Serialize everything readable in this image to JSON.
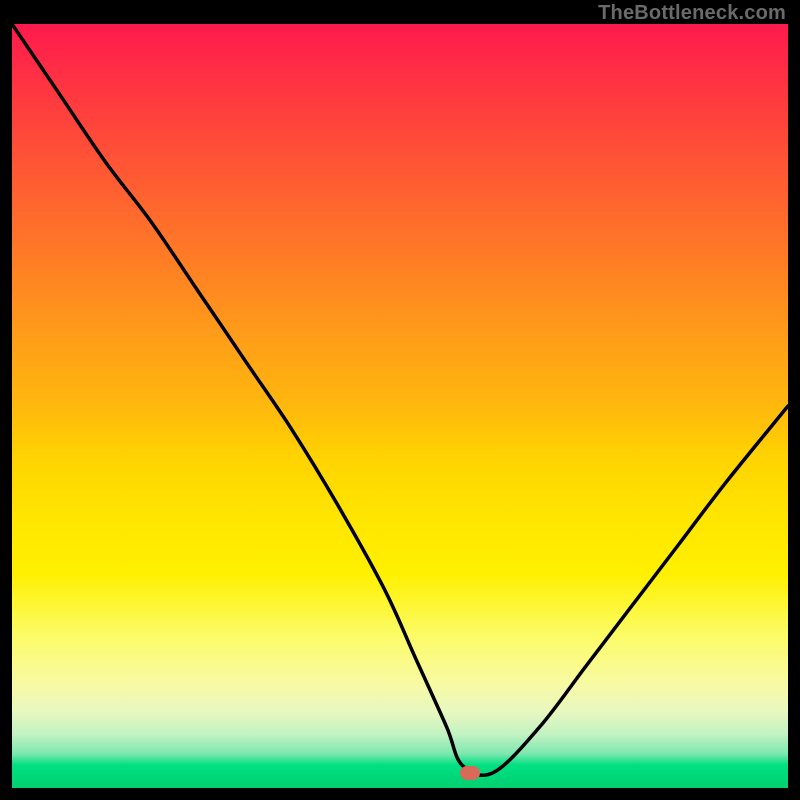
{
  "watermark": "TheBottleneck.com",
  "colors": {
    "frame": "#000000",
    "curve": "#000000",
    "marker": "#d86a5a"
  },
  "chart_data": {
    "type": "line",
    "title": "",
    "xlabel": "",
    "ylabel": "",
    "xlim": [
      0,
      100
    ],
    "ylim": [
      0,
      100
    ],
    "grid": false,
    "legend": false,
    "background": "vertical-gradient-red-to-green",
    "series": [
      {
        "name": "bottleneck-curve",
        "x": [
          0,
          6,
          12,
          18,
          24,
          30,
          36,
          42,
          48,
          52,
          56,
          58,
          62,
          68,
          74,
          80,
          86,
          92,
          100
        ],
        "values": [
          100,
          91,
          82,
          74,
          65,
          56,
          47,
          37,
          26,
          17,
          8,
          3,
          2,
          8,
          16,
          24,
          32,
          40,
          50
        ]
      }
    ],
    "marker": {
      "x": 59,
      "y": 2
    },
    "axes_visible": false
  }
}
